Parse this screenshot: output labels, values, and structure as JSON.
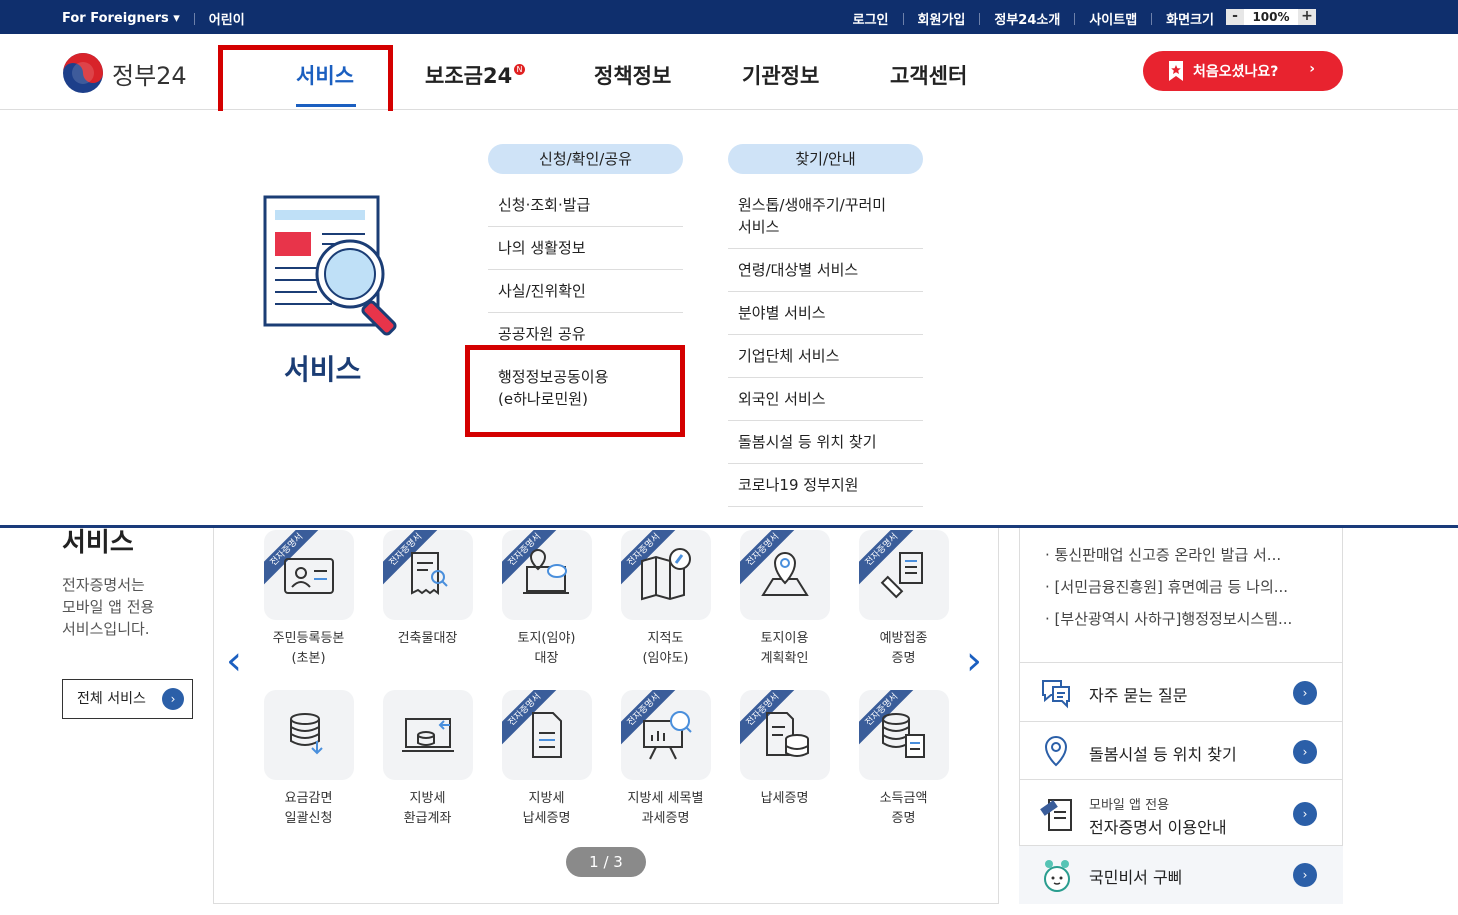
{
  "topbar": {
    "foreigners": "For Foreigners ▾",
    "kids": "어린이",
    "links": [
      "로그인",
      "회원가입",
      "정부24소개",
      "사이트맵",
      "화면크기"
    ],
    "zoom_minus": "-",
    "zoom_value": "100%",
    "zoom_plus": "+"
  },
  "header": {
    "logo_text": "정부24",
    "nav": [
      "서비스",
      "보조금24",
      "정책정보",
      "기관정보",
      "고객센터"
    ],
    "new_badge": "N",
    "first_visit": "처음오셨나요?",
    "first_visit_arrow": "›"
  },
  "mega": {
    "title": "서비스",
    "col1": {
      "heading": "신청/확인/공유",
      "items": [
        "신청·조회·발급",
        "나의 생활정보",
        "사실/진위확인",
        "공공자원 공유",
        "행정정보공동이용",
        "(e하나로민원)"
      ]
    },
    "col2": {
      "heading": "찾기/안내",
      "items": [
        "원스톱/생애주기/꾸러미",
        "서비스",
        "연령/대상별 서비스",
        "분야별 서비스",
        "기업단체 서비스",
        "외국인 서비스",
        "돌봄시설 등 위치 찾기",
        "코로나19 정부지원"
      ]
    }
  },
  "left": {
    "title": "서비스",
    "desc": [
      "전자증명서는",
      "모바일 앱 전용",
      "서비스입니다."
    ],
    "all_button": "전체 서비스",
    "all_button_arrow": "›"
  },
  "services": {
    "ribbon": "전자증명서",
    "items": [
      {
        "l1": "주민등록등본",
        "l2": "(초본)"
      },
      {
        "l1": "건축물대장",
        "l2": ""
      },
      {
        "l1": "토지(임야)",
        "l2": "대장"
      },
      {
        "l1": "지적도",
        "l2": "(임야도)"
      },
      {
        "l1": "토지이용",
        "l2": "계획확인"
      },
      {
        "l1": "예방접종",
        "l2": "증명"
      },
      {
        "l1": "요금감면",
        "l2": "일괄신청"
      },
      {
        "l1": "지방세",
        "l2": "환급계좌"
      },
      {
        "l1": "지방세",
        "l2": "납세증명"
      },
      {
        "l1": "지방세 세목별",
        "l2": "과세증명"
      },
      {
        "l1": "납세증명",
        "l2": ""
      },
      {
        "l1": "소득금액",
        "l2": "증명"
      }
    ],
    "prev": "‹",
    "next": "›",
    "pager": "1 / 3"
  },
  "right": {
    "news": [
      "· 통신판매업 신고증 온라인 발급 서...",
      "· [서민금융진흥원] 휴면예금 등 나의...",
      "· [부산광역시 사하구]행정정보시스템..."
    ],
    "rows": [
      {
        "label": "자주 묻는 질문"
      },
      {
        "label": "돌봄시설 등 위치 찾기"
      },
      {
        "label1": "모바일 앱 전용",
        "label2": "전자증명서 이용안내"
      },
      {
        "label": "국민비서 구삐"
      }
    ],
    "go": "›"
  }
}
